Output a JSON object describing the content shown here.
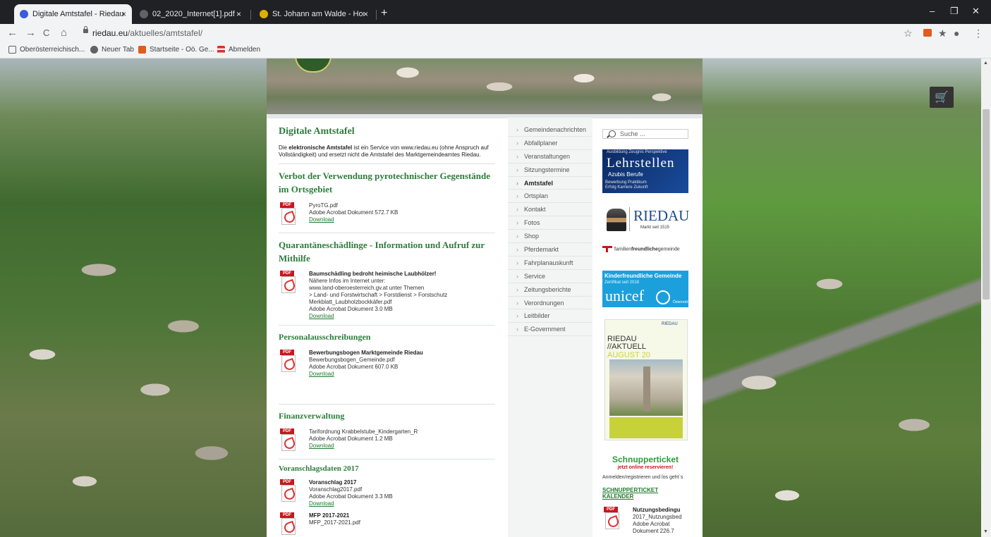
{
  "browser": {
    "tabs": [
      {
        "title": "Digitale Amtstafel - RiedauJeben",
        "active": true,
        "favicon_color": "#3b5bdb"
      },
      {
        "title": "02_2020_Internet[1].pdf",
        "active": false,
        "favicon_color": "#5f6368"
      },
      {
        "title": "St. Johann am Walde - Home - U",
        "active": false,
        "favicon_color": "#e0b000"
      }
    ],
    "tab_close_glyph": "×",
    "newtab_glyph": "+",
    "url_host": "riedau.eu",
    "url_path": "/aktuelles/amtstafel/",
    "bookmarks": [
      {
        "label": "Oberösterreichisch...",
        "color": "#ffffff"
      },
      {
        "label": "Neuer Tab",
        "color": "#5f6368"
      },
      {
        "label": "Startseite - Oö. Ge...",
        "color": "#e35b1a"
      },
      {
        "label": "Abmelden",
        "color": "#d93025"
      }
    ],
    "nav_glyphs": {
      "back": "←",
      "forward": "→",
      "reload": "C",
      "home": "⌂"
    },
    "right_glyphs": {
      "star": "☆",
      "ext": "★",
      "account": "●",
      "menu": "⋮"
    },
    "win_glyphs": {
      "min": "–",
      "max": "❐",
      "close": "✕"
    }
  },
  "page": {
    "title": "Digitale Amtstafel",
    "intro_bold": "elektronische Amtstafel",
    "intro_pre": "Die ",
    "intro_rest": " ist ein Service von www.riedau.eu (ohne Anspruch auf Vollständigkeit) und ersetzt nicht die Amtstafel des Marktgemeindeamtes Riedau.",
    "sections": [
      {
        "heading": "Verbot der Verwendung pyrotechnischer Gegenstände im Ortsgebiet",
        "items": [
          {
            "title": "",
            "lines": [
              "PyroTG.pdf",
              "Adobe Acrobat Dokument 572.7 KB"
            ],
            "link": "Download"
          }
        ]
      },
      {
        "heading": "Quarantäneschädlinge - Information und Aufruf zur Mithilfe",
        "items": [
          {
            "title": "Baumschädling bedroht heimische Laubhölzer!",
            "lines": [
              "Nähere Infos im Internet unter:",
              "www.land-oberoesterreich.gv.at unter Themen",
              "> Land- und Forstwirtschaft > Forstdienst > Forstschutz",
              "Merkblatt_Laubholzbockkäfer.pdf",
              "Adobe Acrobat Dokument 3.0 MB"
            ],
            "link": "Download"
          }
        ]
      },
      {
        "heading": "Personalausschreibungen",
        "items": [
          {
            "title": "Bewerbungsbogen Marktgemeinde Riedau",
            "lines": [
              "Bewerbungsbogen_Gemeinde.pdf",
              "Adobe Acrobat Dokument 607.0 KB"
            ],
            "link": "Download"
          }
        ]
      },
      {
        "heading": "Finanzverwaltung",
        "items": [
          {
            "title": "",
            "lines": [
              "Tarifordnung Krabbelstube_Kindergarten_R",
              "Adobe Acrobat Dokument 1.2 MB"
            ],
            "link": "Download"
          }
        ]
      },
      {
        "heading": "Voranschlagsdaten 2017",
        "items": [
          {
            "title": "Voranschlag 2017",
            "lines": [
              "Voranschlag2017.pdf",
              "Adobe Acrobat Dokument 3.3 MB"
            ],
            "link": "Download"
          },
          {
            "title": "MFP 2017-2021",
            "lines": [
              "MFP_2017-2021.pdf"
            ],
            "link": ""
          }
        ]
      }
    ],
    "pdf_label": "PDF"
  },
  "nav": {
    "items": [
      "Gemeindenachrichten",
      "Abfallplaner",
      "Veranstaltungen",
      "Sitzungstermine",
      "Amtstafel",
      "Ortsplan",
      "Kontakt",
      "Fotos",
      "Shop",
      "Pferdemarkt",
      "Fahrplanauskunft",
      "Service",
      "Zeitungsberichte",
      "Verordnungen",
      "Leitbilder",
      "E-Government"
    ],
    "current": "Amtstafel"
  },
  "sidebar": {
    "search_placeholder": "Suche ...",
    "lehrstellen": {
      "top": "Ausbildung  Zeugnis  Perspektive",
      "main": "Lehrstellen",
      "sub": "Azubis  Berufe",
      "l1": "Bewerbung  Praktikum",
      "l2": "Erfolg  Karriere  Zukunft"
    },
    "riedau": {
      "name": "RIEDAU",
      "sub": "Markt seit 1515"
    },
    "ffg": {
      "pre": "familien",
      "bold": "freundliche",
      "post": "gemeinde"
    },
    "unicef": {
      "l1": "Kinderfreundliche Gemeinde",
      "l2": "Zertifikat seit 2018",
      "brand": "unicef",
      "country": "Österreich"
    },
    "magazine": {
      "title": "RIEDAU\n//AKTUELL",
      "issue": "AUGUST 20",
      "logo": "RIEDAU"
    },
    "schnupper": {
      "title": "Schnupperticket",
      "sub": "jetzt online reservieren!"
    },
    "login_text": "Anmelden/registrieren und los geht`s",
    "kalender_link": "SCHNUPPERTICKET KALENDER",
    "doc": {
      "title": "Nutzungsbedingu",
      "lines": [
        "2017_Nutzungsbed",
        "Adobe Acrobat",
        "Dokument 226.7"
      ]
    }
  },
  "cart_glyph": "🛒",
  "colors": {
    "green_heading": "#2d7d3c",
    "link": "#1f7a2c",
    "pdf_red": "#c8161d",
    "unicef_blue": "#1ca0dc"
  }
}
